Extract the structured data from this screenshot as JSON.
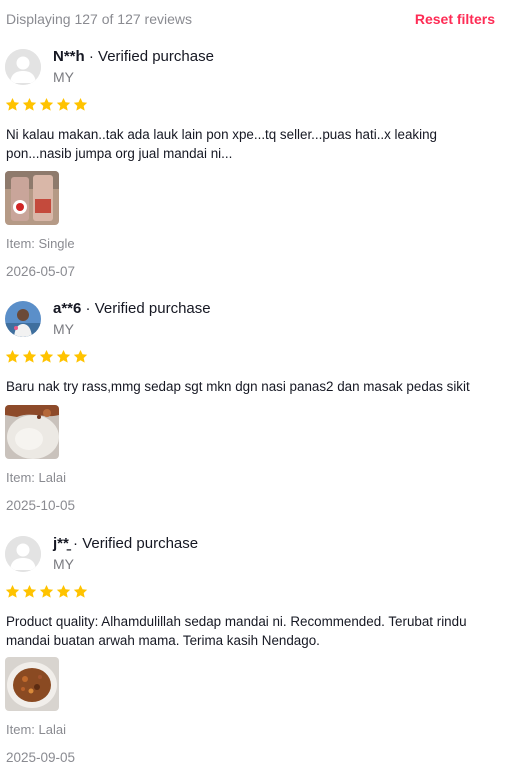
{
  "header": {
    "count_text": "Displaying 127 of 127 reviews",
    "reset_label": "Reset filters",
    "reset_color": "#fe2c55"
  },
  "colors": {
    "star": "#ffc300",
    "muted_text": "#8a8b91"
  },
  "reviews": [
    {
      "user": "N**h",
      "separator": " · ",
      "verified": "Verified purchase",
      "region": "MY",
      "avatar": "default-avatar-icon",
      "rating": 5,
      "text": "Ni kalau makan..tak ada lauk lain pon xpe...tq seller...puas hati..x leaking pon...nasib jumpa org jual mandai ni...",
      "item_prefix": "Item: ",
      "item": "Single",
      "date": "2026-05-07"
    },
    {
      "user": "a**6",
      "separator": " · ",
      "verified": "Verified purchase",
      "region": "MY",
      "avatar": "photo-avatar",
      "rating": 5,
      "text": "Baru nak try rass,mmg sedap sgt mkn dgn nasi panas2 dan masak pedas sikit",
      "item_prefix": "Item: ",
      "item": "Lalai",
      "date": "2025-10-05"
    },
    {
      "user": "j**̱",
      "separator": " · ",
      "verified": "Verified purchase",
      "region": "MY",
      "avatar": "default-avatar-icon",
      "rating": 5,
      "text": "Product quality: Alhamdulillah sedap mandai ni. Recommended. Terubat rindu mandai buatan arwah mama. Terima kasih Nendago.",
      "item_prefix": "Item: ",
      "item": "Lalai",
      "date": "2025-09-05"
    }
  ]
}
